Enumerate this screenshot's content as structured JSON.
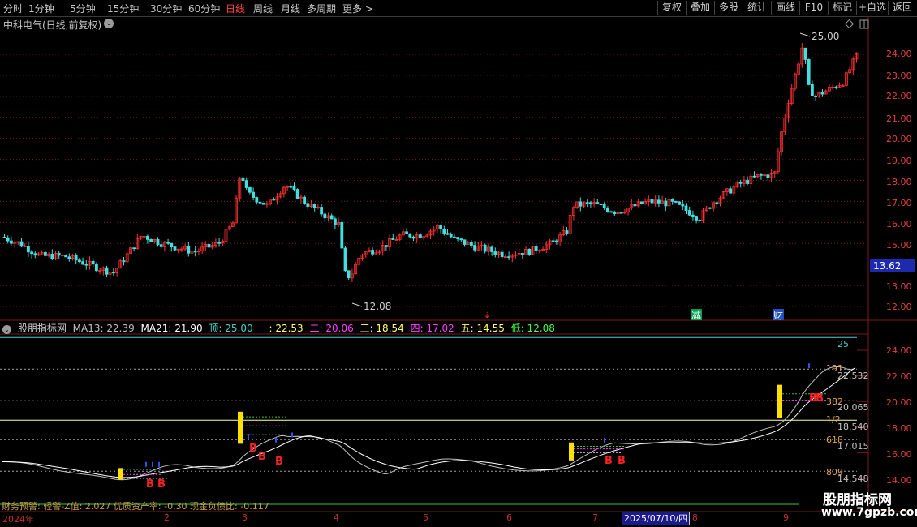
{
  "toolbar": {
    "periods": [
      "分时",
      "1分钟",
      "5分钟",
      "15分钟",
      "30分钟",
      "60分钟",
      "日线",
      "周线",
      "月线",
      "多周期",
      "更多"
    ],
    "active_period": "日线",
    "right_buttons": [
      "复权",
      "叠加",
      "多股",
      "统计",
      "画线",
      "F10",
      "标记",
      "+自选",
      "返回"
    ]
  },
  "stock": {
    "title": "中科电气(日线,前复权)",
    "last_price": "13.62"
  },
  "price_axis": [
    "24.00",
    "23.00",
    "22.00",
    "21.00",
    "20.00",
    "19.00",
    "18.00",
    "17.00",
    "16.00",
    "15.00",
    "14.00",
    "13.00",
    "12.00"
  ],
  "price_markers": {
    "high": "25.00",
    "low": "12.08"
  },
  "event_markers": [
    {
      "label": "减",
      "color": "#00a050"
    },
    {
      "label": "财",
      "color": "#2050c0"
    }
  ],
  "indicator": {
    "name": "股朋指标网",
    "values": [
      {
        "text": "MA13: 22.39",
        "color": "#c0c0c0"
      },
      {
        "text": "MA21: 21.90",
        "color": "#ffffff"
      },
      {
        "text": "顶: 25.00",
        "color": "#40d0d0"
      },
      {
        "text": "一: 22.53",
        "color": "#ffff60"
      },
      {
        "text": "二: 20.06",
        "color": "#ff40ff"
      },
      {
        "text": "三: 18.54",
        "color": "#ffff60"
      },
      {
        "text": "四: 17.02",
        "color": "#ff40ff"
      },
      {
        "text": "五: 14.55",
        "color": "#ffff60"
      },
      {
        "text": "低: 12.08",
        "color": "#40ff40"
      }
    ],
    "axis": [
      "24.00",
      "22.00",
      "20.00",
      "18.00",
      "16.00",
      "14.00"
    ],
    "fib_labels": [
      "191",
      "382",
      "1/2",
      "618",
      "809"
    ],
    "level_values": [
      "25",
      "22.532",
      "20.065",
      "18.540",
      "17.015",
      "14.548"
    ],
    "signal_label": "B"
  },
  "financial_warning": "财务预警: 轻警-Z值: 2.027 优质资产率: -0.30 现金负债比: -0.117",
  "date_axis": {
    "months": [
      "2024年",
      "2",
      "3",
      "4",
      "5",
      "6",
      "7",
      "8",
      "9"
    ],
    "highlight": "2025/07/10/四"
  },
  "watermark": {
    "name": "股朋指标网",
    "url": "www.7gpzb.com"
  },
  "colors": {
    "up": "#ff3030",
    "down": "#40e0e0",
    "grid": "#7a1a1a",
    "accent": "#ff4040"
  }
}
